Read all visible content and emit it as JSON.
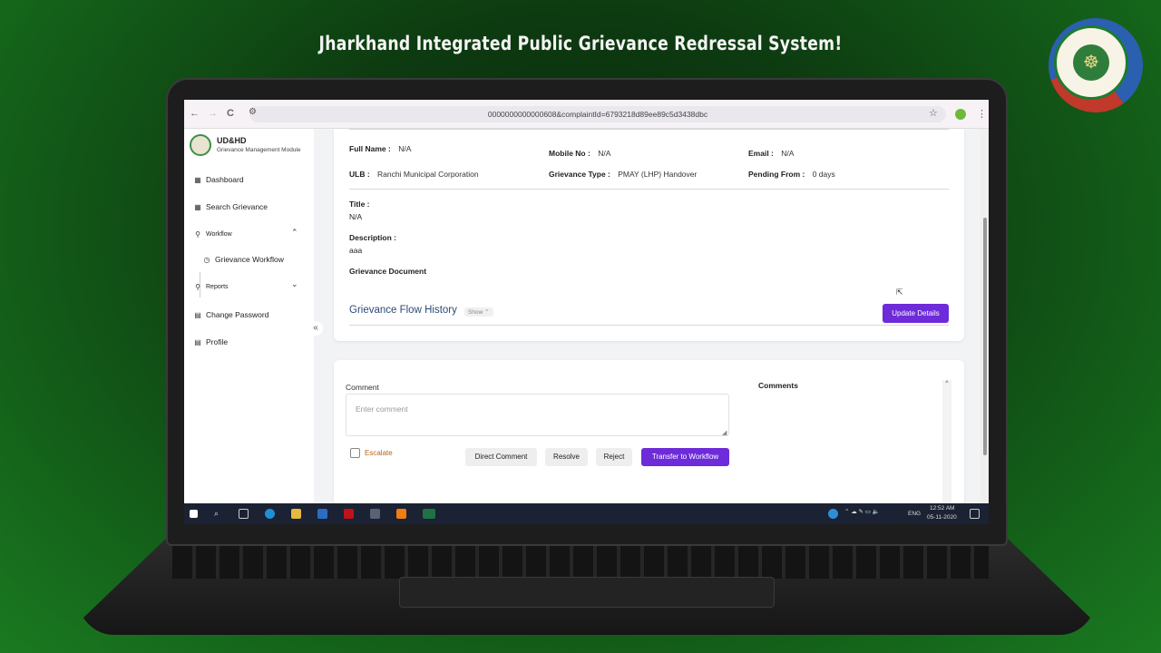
{
  "banner": {
    "title": "Jharkhand Integrated Public Grievance Redressal System!"
  },
  "browser": {
    "url": "0000000000000608&complaintId=6793218d89ee89c5d3438dbc",
    "back": "←",
    "forward": "→",
    "reload": "C",
    "star": "☆",
    "menu": "⋮"
  },
  "sidebar": {
    "brand_title": "UD&HD",
    "brand_subtitle": "Grievance Management Module",
    "items": [
      {
        "label": "Dashboard",
        "icon": "grid-icon"
      },
      {
        "label": "Search Grievance",
        "icon": "grid-icon"
      },
      {
        "label": "Workflow",
        "icon": "user-flow-icon",
        "expanded": true
      },
      {
        "label": "Grievance Workflow",
        "icon": "clock-icon"
      },
      {
        "label": "Reports",
        "icon": "user-flow-icon",
        "expanded": false
      },
      {
        "label": "Change Password",
        "icon": "document-icon"
      },
      {
        "label": "Profile",
        "icon": "document-icon"
      }
    ],
    "collapse": "«"
  },
  "details": {
    "full_name_label": "Full Name :",
    "full_name": "N/A",
    "mobile_label": "Mobile No :",
    "mobile": "N/A",
    "email_label": "Email :",
    "email": "N/A",
    "ulb_label": "ULB :",
    "ulb": "Ranchi Municipal Corporation",
    "type_label": "Grievance Type :",
    "type": "PMAY (LHP) Handover",
    "pending_label": "Pending From :",
    "pending": "0 days",
    "title_label": "Title :",
    "title": "N/A",
    "description_label": "Description :",
    "description": "aaa",
    "document_label": "Grievance Document",
    "history_title": "Grievance Flow History",
    "history_toggle": "Show ⌃",
    "update_button": "Update Details"
  },
  "comment_panel": {
    "comment_label": "Comment",
    "comment_placeholder": "Enter comment",
    "escalate_label": "Escalate",
    "escalate_checked": false,
    "buttons": {
      "direct_comment": "Direct Comment",
      "resolve": "Resolve",
      "reject": "Reject",
      "transfer": "Transfer to Workflow"
    },
    "comments_title": "Comments"
  },
  "taskbar": {
    "lang": "ENG",
    "time": "12:52 AM",
    "date": "05-11-2020"
  },
  "colors": {
    "accent": "#6d2bd9",
    "history_title": "#2d4a77",
    "escalate": "#b5651d"
  }
}
